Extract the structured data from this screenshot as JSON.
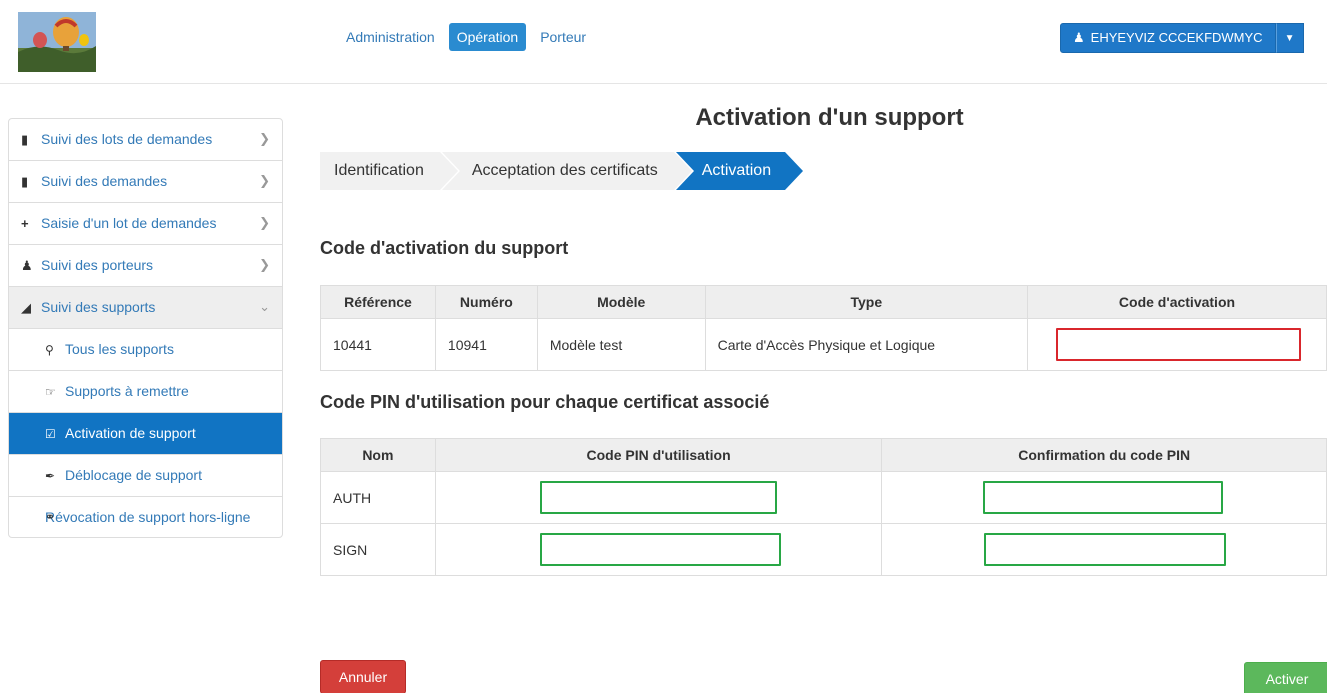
{
  "header": {
    "nav": [
      "Administration",
      "Opération",
      "Porteur"
    ],
    "user": "EHYEYVIZ CCCEKFDWMYC"
  },
  "sidebar": {
    "items": [
      {
        "label": "Suivi des lots de demandes",
        "icon": "file-icon"
      },
      {
        "label": "Suivi des demandes",
        "icon": "file-icon"
      },
      {
        "label": "Saisie d'un lot de demandes",
        "icon": "plus-icon"
      },
      {
        "label": "Suivi des porteurs",
        "icon": "user-icon"
      },
      {
        "label": "Suivi des supports",
        "icon": "tags-icon"
      }
    ],
    "subitems": [
      {
        "label": "Tous les supports",
        "icon": "search-icon"
      },
      {
        "label": "Supports à remettre",
        "icon": "hand-right-icon"
      },
      {
        "label": "Activation de support",
        "icon": "check-icon"
      },
      {
        "label": "Déblocage de support",
        "icon": "wrench-icon"
      },
      {
        "label": "Révocation de support hors-ligne",
        "icon": "headphones-icon"
      }
    ]
  },
  "page": {
    "title": "Activation d'un support",
    "steps": [
      "Identification",
      "Acceptation des certificats",
      "Activation"
    ]
  },
  "activation": {
    "heading": "Code d'activation du support",
    "columns": [
      "Référence",
      "Numéro",
      "Modèle",
      "Type",
      "Code d'activation"
    ],
    "row": {
      "reference": "10441",
      "numero": "10941",
      "modele": "Modèle test",
      "type": "Carte d'Accès Physique et Logique",
      "code": ""
    }
  },
  "pin": {
    "heading": "Code PIN d'utilisation pour chaque certificat associé",
    "columns": [
      "Nom",
      "Code PIN d'utilisation",
      "Confirmation du code PIN"
    ],
    "rows": [
      {
        "nom": "AUTH",
        "pin": "",
        "confirm": ""
      },
      {
        "nom": "SIGN",
        "pin": "",
        "confirm": ""
      }
    ]
  },
  "buttons": {
    "cancel": "Annuler",
    "activate": "Activer"
  },
  "colors": {
    "primary": "#1174c3",
    "danger": "#d43f3a",
    "success": "#5cb85c",
    "highlight_red": "#d9262c",
    "highlight_green": "#28a745"
  }
}
